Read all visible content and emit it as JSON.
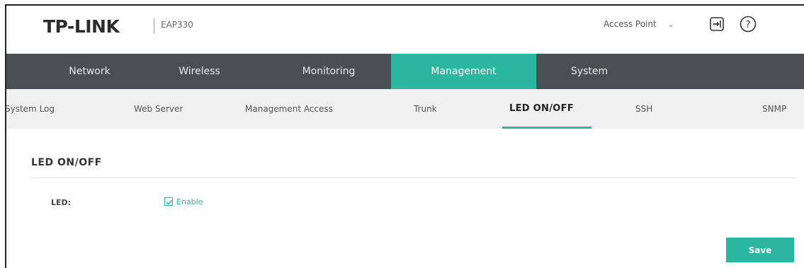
{
  "header": {
    "brand": "TP-LINK",
    "model": "EAP330",
    "mode_select": {
      "value": "Access Point"
    },
    "icons": {
      "logout": "logout-icon",
      "help": "help-icon"
    }
  },
  "main_nav": {
    "tabs": [
      {
        "label": "Network"
      },
      {
        "label": "Wireless"
      },
      {
        "label": "Monitoring"
      },
      {
        "label": "Management",
        "active": true
      },
      {
        "label": "System"
      }
    ]
  },
  "sub_nav": {
    "items": [
      {
        "label": "System Log"
      },
      {
        "label": "Web Server"
      },
      {
        "label": "Management Access"
      },
      {
        "label": "Trunk"
      },
      {
        "label": "LED ON/OFF",
        "active": true
      },
      {
        "label": "SSH"
      },
      {
        "label": "SNMP"
      }
    ]
  },
  "section": {
    "title": "LED ON/OFF",
    "led_label": "LED:",
    "enable_label": "Enable",
    "enable_checked": true
  },
  "actions": {
    "save_label": "Save"
  },
  "colors": {
    "accent": "#2bb6a0",
    "nav_bg": "#4a4f53",
    "subnav_bg": "#f0f0f0"
  }
}
